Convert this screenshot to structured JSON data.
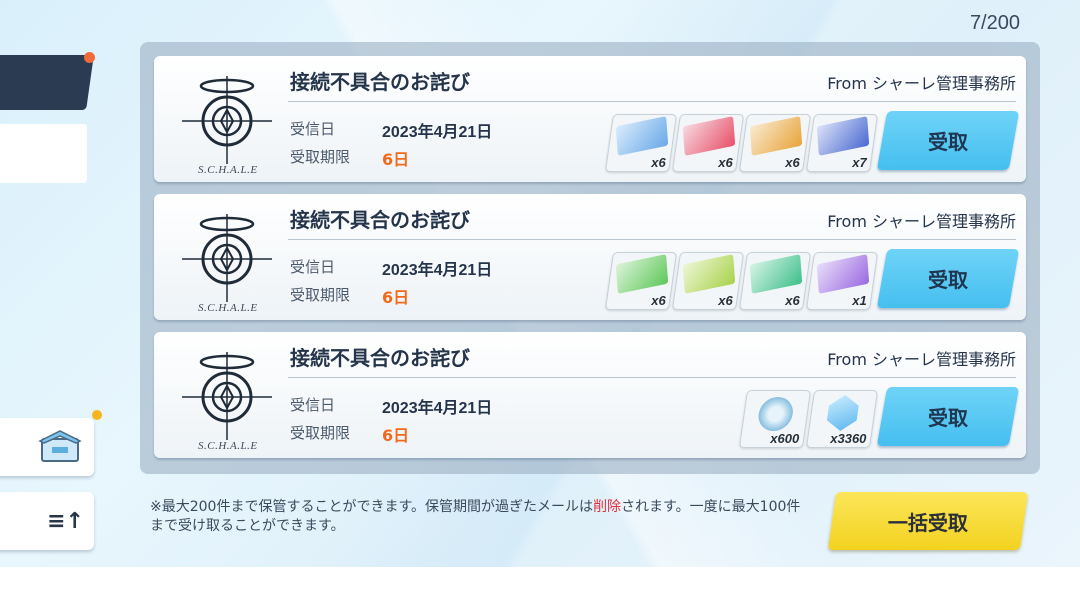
{
  "counter": "7/200",
  "mails": [
    {
      "title": "接続不具合のお詫び",
      "from": "From シャーレ管理事務所",
      "received_label": "受信日",
      "received_date": "2023年4月21日",
      "expiry_label": "受取期限",
      "expiry_value": "6日",
      "logo_text": "S.C.H.A.L.E",
      "claim_label": "受取",
      "items": [
        {
          "icon": "blue-ticket-icon",
          "qty": "x6",
          "color": "#6aa8e8"
        },
        {
          "icon": "red-ticket-icon",
          "qty": "x6",
          "color": "#e8506a"
        },
        {
          "icon": "gold-ticket-icon",
          "qty": "x6",
          "color": "#e8a43a"
        },
        {
          "icon": "navy-ticket-icon",
          "qty": "x7",
          "color": "#4a6ad0"
        }
      ]
    },
    {
      "title": "接続不具合のお詫び",
      "from": "From シャーレ管理事務所",
      "received_label": "受信日",
      "received_date": "2023年4月21日",
      "expiry_label": "受取期限",
      "expiry_value": "6日",
      "logo_text": "S.C.H.A.L.E",
      "claim_label": "受取",
      "items": [
        {
          "icon": "green-ticket-icon",
          "qty": "x6",
          "color": "#5ec85a"
        },
        {
          "icon": "lime-ticket-icon",
          "qty": "x6",
          "color": "#a8d24a"
        },
        {
          "icon": "teal-ticket-icon",
          "qty": "x6",
          "color": "#3ec08a"
        },
        {
          "icon": "purple-ticket-icon",
          "qty": "x1",
          "color": "#9a6ae0"
        }
      ]
    },
    {
      "title": "接続不具合のお詫び",
      "from": "From シャーレ管理事務所",
      "received_label": "受信日",
      "received_date": "2023年4月21日",
      "expiry_label": "受取期限",
      "expiry_value": "6日",
      "logo_text": "S.C.H.A.L.E",
      "claim_label": "受取",
      "items": [
        {
          "icon": "credit-coin-icon",
          "qty": "x600",
          "color": "#7ab8dc"
        },
        {
          "icon": "pyroxene-crystal-icon",
          "qty": "x3360",
          "color": "#5ab6f0"
        }
      ]
    }
  ],
  "notice_part1": "※最大200件まで保管することができます。保管期間が過ぎたメールは",
  "notice_red": "削除",
  "notice_part2": "されます。一度に最大100件まで受け取ることができます。",
  "bulk_claim_label": "一括受取",
  "sort_icon_text": "≡↑",
  "colors": {
    "accent_blue": "#45bff0",
    "accent_yellow": "#f3d21f",
    "deadline": "#f06a1e",
    "notice_red": "#e0323c"
  }
}
